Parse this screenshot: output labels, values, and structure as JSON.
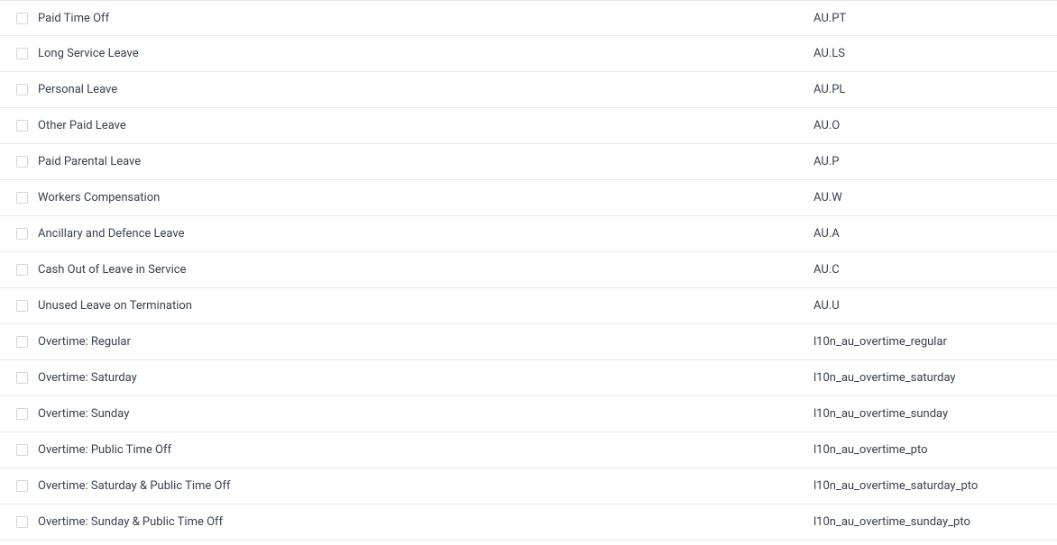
{
  "rows": [
    {
      "name": "Paid Time Off",
      "code": "AU.PT"
    },
    {
      "name": "Long Service Leave",
      "code": "AU.LS"
    },
    {
      "name": "Personal Leave",
      "code": "AU.PL"
    },
    {
      "name": "Other Paid Leave",
      "code": "AU.O"
    },
    {
      "name": "Paid Parental Leave",
      "code": "AU.P"
    },
    {
      "name": "Workers Compensation",
      "code": "AU.W"
    },
    {
      "name": "Ancillary and Defence Leave",
      "code": "AU.A"
    },
    {
      "name": "Cash Out of Leave in Service",
      "code": "AU.C"
    },
    {
      "name": "Unused Leave on Termination",
      "code": "AU.U"
    },
    {
      "name": "Overtime: Regular",
      "code": "l10n_au_overtime_regular"
    },
    {
      "name": "Overtime: Saturday",
      "code": "l10n_au_overtime_saturday"
    },
    {
      "name": "Overtime: Sunday",
      "code": "l10n_au_overtime_sunday"
    },
    {
      "name": "Overtime: Public Time Off",
      "code": "l10n_au_overtime_pto"
    },
    {
      "name": "Overtime: Saturday & Public Time Off",
      "code": "l10n_au_overtime_saturday_pto"
    },
    {
      "name": "Overtime: Sunday & Public Time Off",
      "code": "l10n_au_overtime_sunday_pto"
    }
  ]
}
